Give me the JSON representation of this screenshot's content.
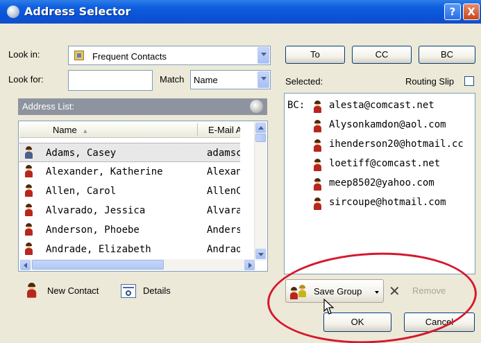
{
  "window": {
    "title": "Address Selector",
    "help_label": "?",
    "close_label": "X"
  },
  "look_in": {
    "label": "Look in:",
    "value": "Frequent Contacts"
  },
  "look_for": {
    "label": "Look for:",
    "value": ""
  },
  "match": {
    "label": "Match",
    "value": "Name"
  },
  "address_list": {
    "label": "Address List:",
    "columns": [
      "Name",
      "E-Mail Adc"
    ],
    "sort_indicator": "▲",
    "rows": [
      {
        "name": "Adams, Casey",
        "email": "adamsc@"
      },
      {
        "name": "Alexander, Katherine",
        "email": "Alexande"
      },
      {
        "name": "Allen, Carol",
        "email": "AllenC@la"
      },
      {
        "name": "Alvarado, Jessica",
        "email": "Alvarado."
      },
      {
        "name": "Anderson, Phoebe",
        "email": "Andersor"
      },
      {
        "name": "Andrade, Elizabeth",
        "email": "AndradeE"
      }
    ]
  },
  "recipient_buttons": {
    "to": "To",
    "cc": "CC",
    "bc": "BC"
  },
  "selected": {
    "label": "Selected:",
    "routing_slip": "Routing Slip",
    "prefix": "BC:",
    "items": [
      "alesta@comcast.net",
      "Alysonkamdon@aol.com",
      "ihenderson20@hotmail.cc",
      "loetiff@comcast.net",
      "meep8502@yahoo.com",
      "sircoupe@hotmail.com"
    ]
  },
  "footer": {
    "new_contact": "New Contact",
    "details": "Details",
    "save_group": "Save Group",
    "remove": "Remove",
    "ok": "OK",
    "cancel": "Cancel"
  },
  "colors": {
    "title_blue": "#0a52d6",
    "annotation_red": "#d6172e",
    "selected_row": "#e8e8e8"
  }
}
